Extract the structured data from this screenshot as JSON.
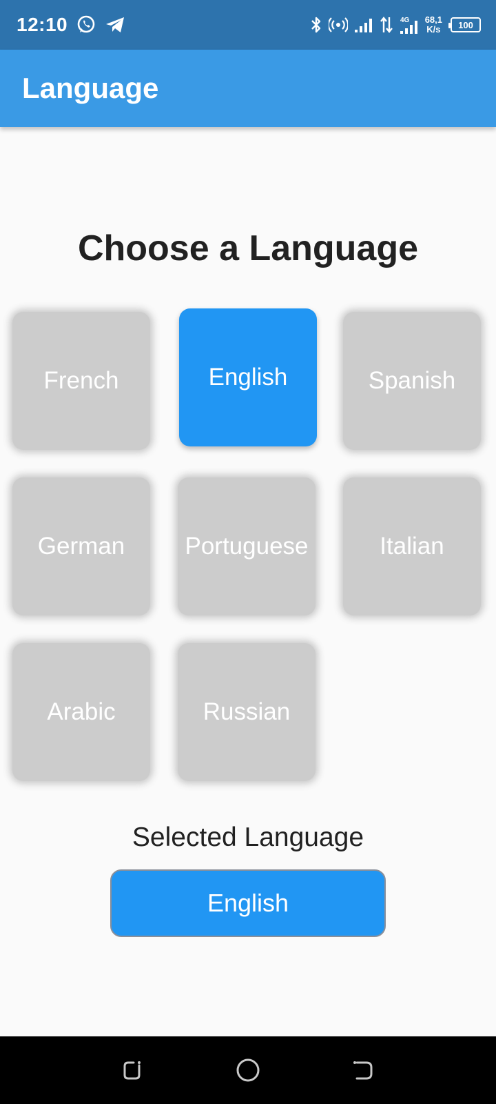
{
  "status_bar": {
    "time": "12:10",
    "network_type": "4G",
    "speed_value": "68,1",
    "speed_unit": "K/s",
    "battery": "100",
    "icons": [
      "whatsapp-icon",
      "telegram-icon",
      "bluetooth-icon",
      "hotspot-icon",
      "signal-icon",
      "data-arrows-icon",
      "signal-4g-icon"
    ]
  },
  "app_bar": {
    "title": "Language"
  },
  "main": {
    "heading": "Choose a Language",
    "languages": [
      {
        "label": "French",
        "selected": false
      },
      {
        "label": "English",
        "selected": true
      },
      {
        "label": "Spanish",
        "selected": false
      },
      {
        "label": "German",
        "selected": false
      },
      {
        "label": "Portuguese",
        "selected": false
      },
      {
        "label": "Italian",
        "selected": false
      },
      {
        "label": "Arabic",
        "selected": false
      },
      {
        "label": "Russian",
        "selected": false
      }
    ],
    "selected_label": "Selected Language",
    "selected_value": "English"
  },
  "colors": {
    "status_bar": "#2d73ad",
    "app_bar": "#3a9ae5",
    "selected": "#2196f3",
    "unselected": "#cccccc",
    "background": "#fafafa"
  },
  "nav_bar": {
    "icons": [
      "recents-icon",
      "home-icon",
      "back-icon"
    ]
  }
}
